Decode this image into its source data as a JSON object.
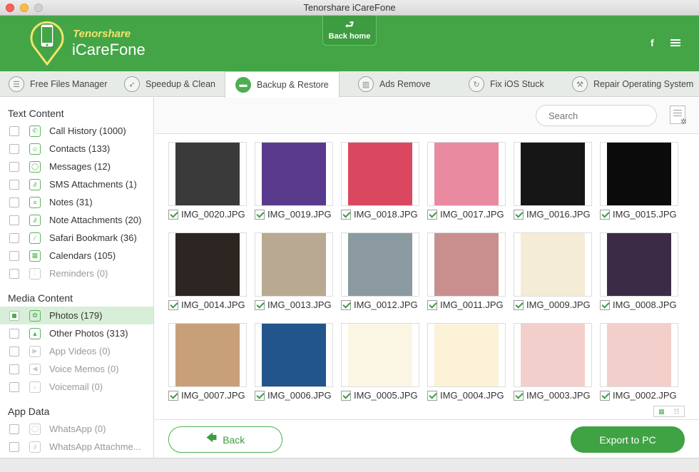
{
  "window": {
    "title": "Tenorshare iCareFone"
  },
  "brand": {
    "line1": "Tenorshare",
    "line2": "iCareFone"
  },
  "header": {
    "back_home": "Back home",
    "facebook": "f"
  },
  "tabs": [
    {
      "label": "Free Files Manager",
      "icon": "files-icon"
    },
    {
      "label": "Speedup & Clean",
      "icon": "rocket-icon"
    },
    {
      "label": "Backup & Restore",
      "icon": "folder-icon",
      "active": true
    },
    {
      "label": "Ads Remove",
      "icon": "trash-icon"
    },
    {
      "label": "Fix iOS Stuck",
      "icon": "refresh-icon"
    },
    {
      "label": "Repair Operating System",
      "icon": "wrench-icon"
    }
  ],
  "sidebar": {
    "sections": [
      {
        "title": "Text Content",
        "items": [
          {
            "label": "Call History (1000)",
            "icon": "phone-icon"
          },
          {
            "label": "Contacts (133)",
            "icon": "contacts-icon"
          },
          {
            "label": "Messages (12)",
            "icon": "message-icon"
          },
          {
            "label": "SMS Attachments (1)",
            "icon": "paperclip-icon"
          },
          {
            "label": "Notes (31)",
            "icon": "notes-icon"
          },
          {
            "label": "Note Attachments (20)",
            "icon": "paperclip-icon"
          },
          {
            "label": "Safari Bookmark (36)",
            "icon": "bookmark-icon"
          },
          {
            "label": "Calendars (105)",
            "icon": "calendar-icon"
          },
          {
            "label": "Reminders (0)",
            "icon": "reminder-icon",
            "dim": true
          }
        ]
      },
      {
        "title": "Media Content",
        "items": [
          {
            "label": "Photos (179)",
            "icon": "flower-icon",
            "selected": true
          },
          {
            "label": "Other Photos (313)",
            "icon": "image-icon"
          },
          {
            "label": "App Videos (0)",
            "icon": "play-icon",
            "dim": true
          },
          {
            "label": "Voice Memos (0)",
            "icon": "speaker-icon",
            "dim": true
          },
          {
            "label": "Voicemail (0)",
            "icon": "microphone-icon",
            "dim": true
          }
        ]
      },
      {
        "title": "App Data",
        "items": [
          {
            "label": "WhatsApp (0)",
            "icon": "chat-icon",
            "dim": true
          },
          {
            "label": "WhatsApp Attachme...",
            "icon": "paperclip-icon",
            "dim": true
          }
        ]
      }
    ]
  },
  "search": {
    "placeholder": "Search"
  },
  "photos": [
    {
      "name": "IMG_0020.JPG",
      "color": "#3a3a3a"
    },
    {
      "name": "IMG_0019.JPG",
      "color": "#5a3a8c"
    },
    {
      "name": "IMG_0018.JPG",
      "color": "#d9485f"
    },
    {
      "name": "IMG_0017.JPG",
      "color": "#e98aa0"
    },
    {
      "name": "IMG_0016.JPG",
      "color": "#161616"
    },
    {
      "name": "IMG_0015.JPG",
      "color": "#0b0b0b"
    },
    {
      "name": "IMG_0014.JPG",
      "color": "#2d2521"
    },
    {
      "name": "IMG_0013.JPG",
      "color": "#b9a992"
    },
    {
      "name": "IMG_0012.JPG",
      "color": "#8a9aa0"
    },
    {
      "name": "IMG_0011.JPG",
      "color": "#c98f8f"
    },
    {
      "name": "IMG_0009.JPG",
      "color": "#f5ecd6"
    },
    {
      "name": "IMG_0008.JPG",
      "color": "#3c2b46"
    },
    {
      "name": "IMG_0007.JPG",
      "color": "#c7a07a"
    },
    {
      "name": "IMG_0006.JPG",
      "color": "#22558c"
    },
    {
      "name": "IMG_0005.JPG",
      "color": "#fbf6e3"
    },
    {
      "name": "IMG_0004.JPG",
      "color": "#fbf2d8"
    },
    {
      "name": "IMG_0003.JPG",
      "color": "#f3cfcb"
    },
    {
      "name": "IMG_0002.JPG",
      "color": "#f3cfcb"
    }
  ],
  "footer": {
    "back": "Back",
    "export": "Export to PC"
  },
  "colors": {
    "accent": "#44a547",
    "selected_bg": "#d7efd8"
  }
}
